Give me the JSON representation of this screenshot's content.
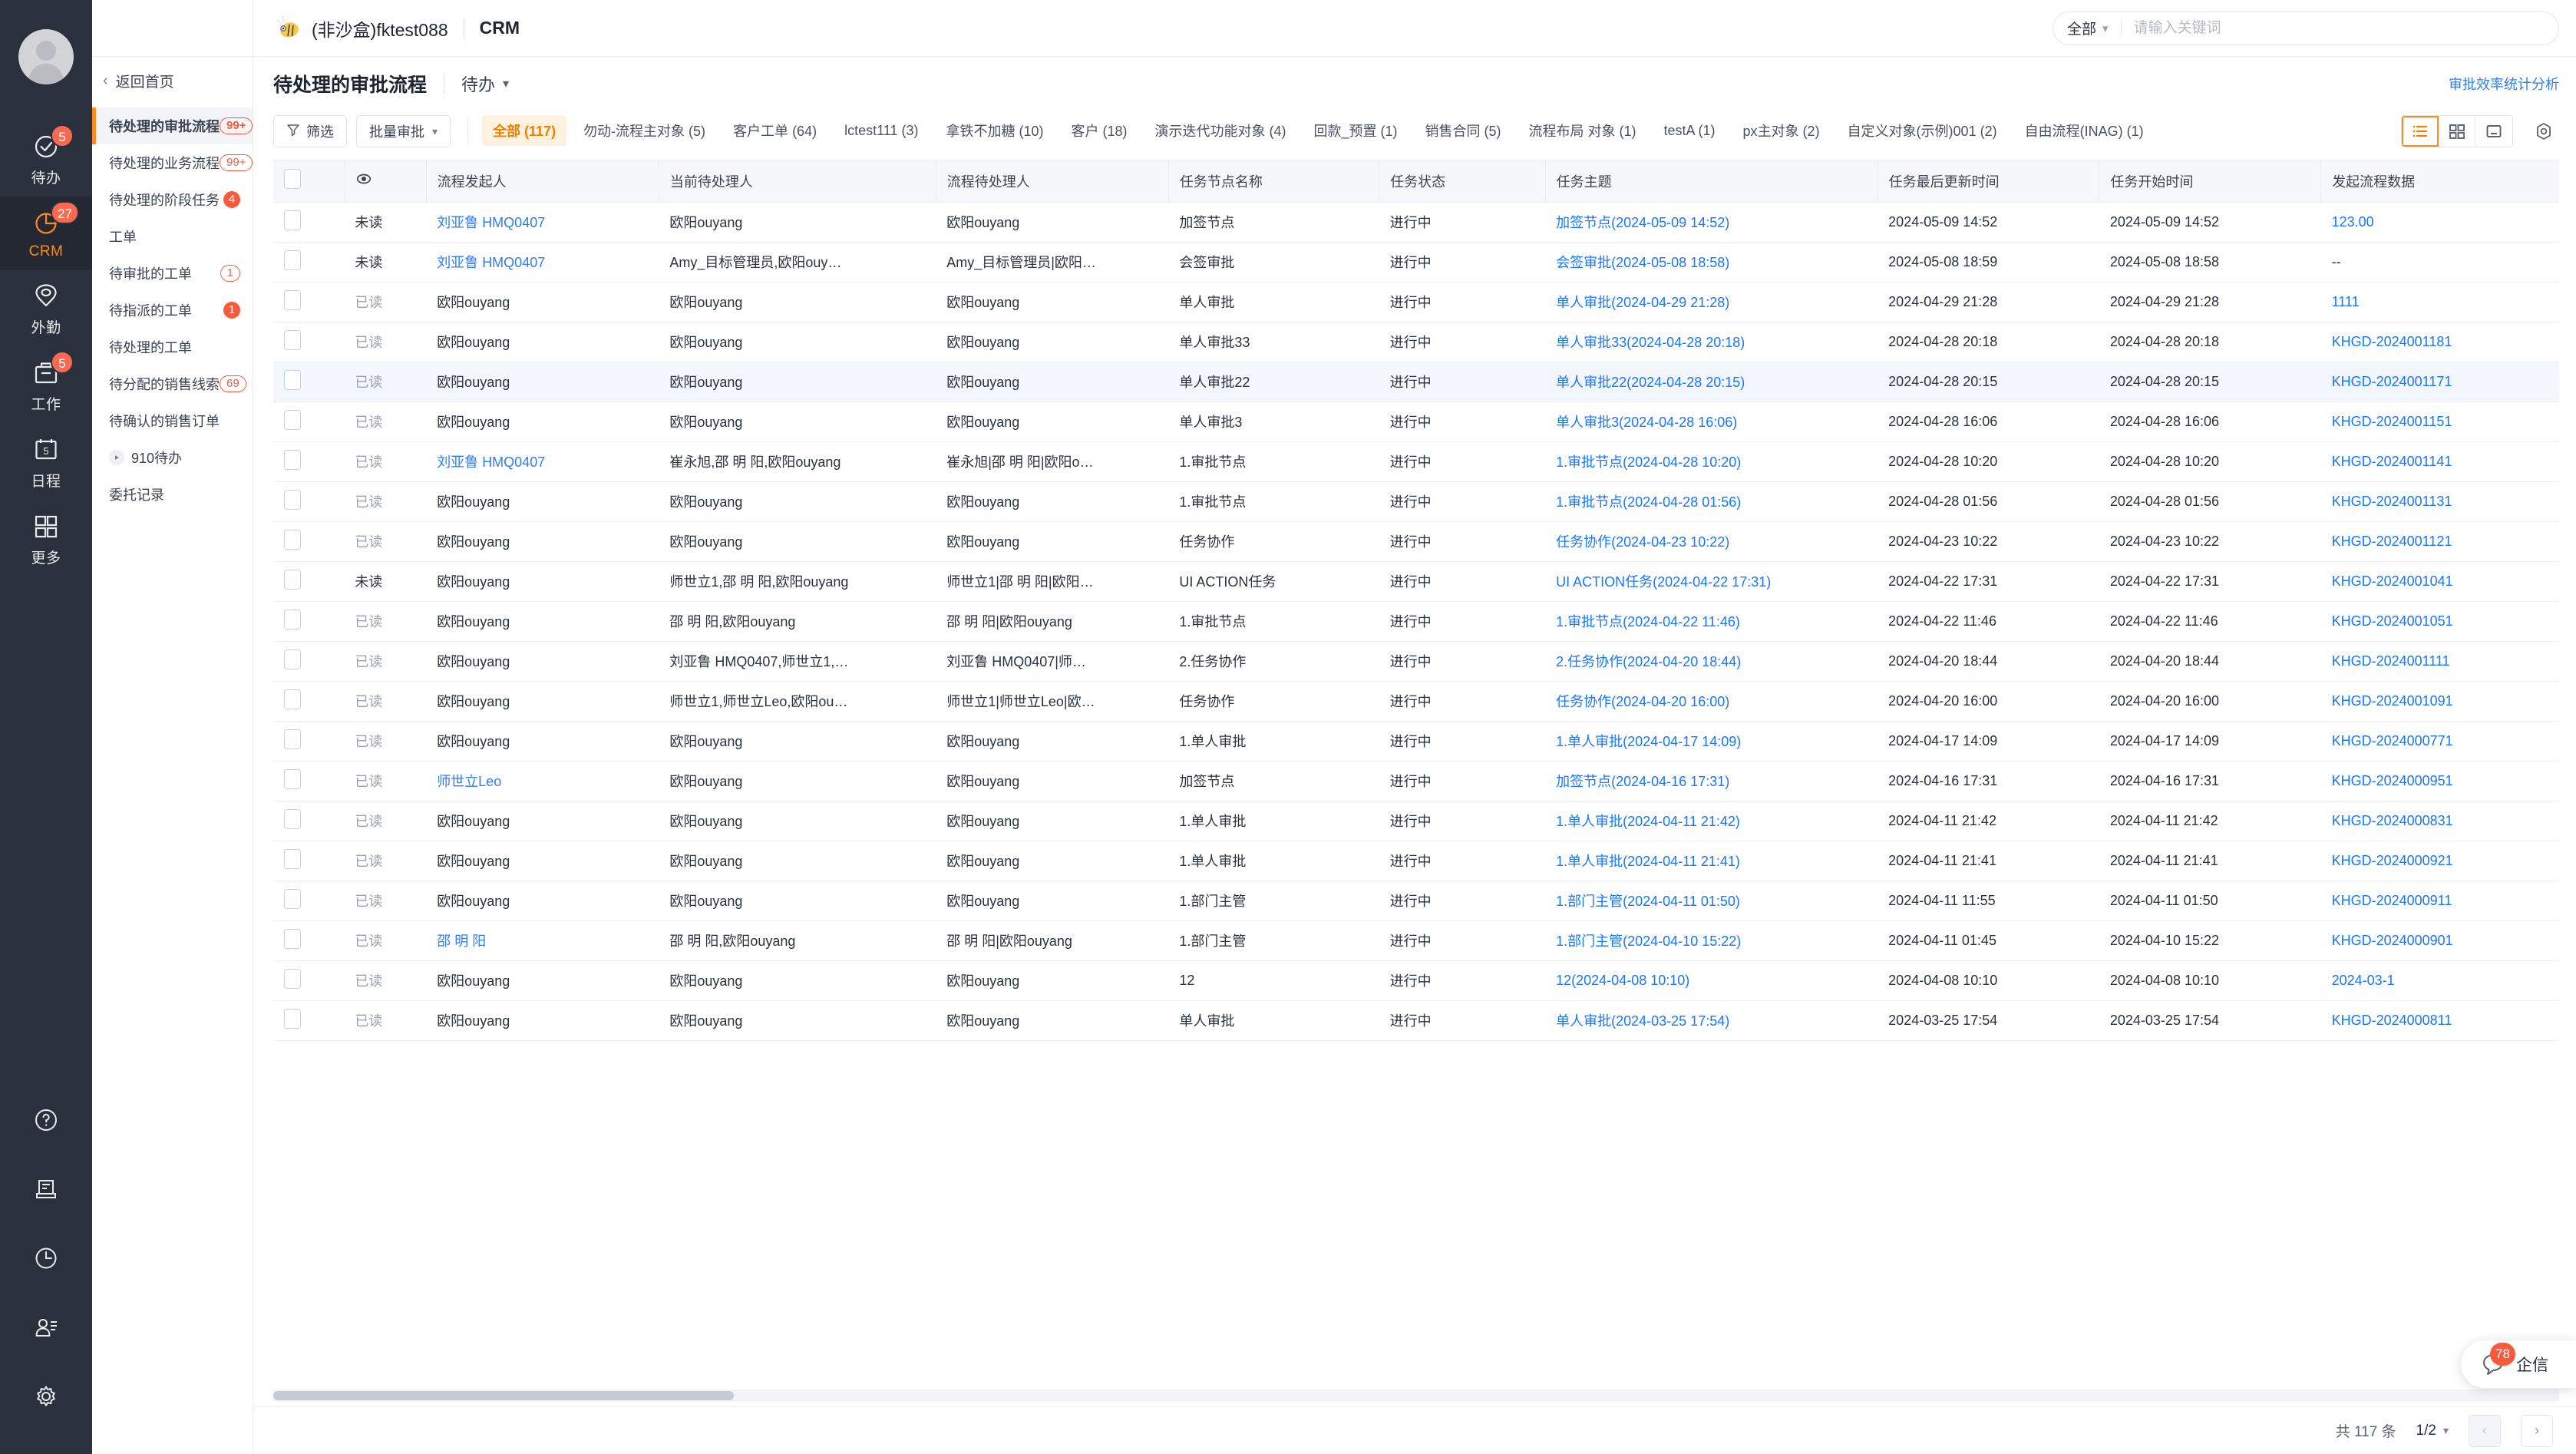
{
  "colors": {
    "accent": "#ff8a1f",
    "link": "#2f7ef0",
    "badge": "#fa5a3c",
    "rail_bg": "#2b313c",
    "chip_active_bg": "#fdf1e0"
  },
  "topbar": {
    "brand_icon": "bee-logo",
    "org_name": "(非沙盒)fktest088",
    "app_name": "CRM",
    "search": {
      "scope": "全部",
      "placeholder": "请输入关键词",
      "value": ""
    }
  },
  "rail": {
    "items": [
      {
        "label": "待办",
        "icon": "check-circle-icon",
        "badge": "5",
        "active": false
      },
      {
        "label": "CRM",
        "icon": "pie-chart-icon",
        "badge": "27",
        "active": true
      },
      {
        "label": "外勤",
        "icon": "location-pin-icon",
        "badge": "",
        "active": false
      },
      {
        "label": "工作",
        "icon": "briefcase-icon",
        "badge": "5",
        "active": false
      },
      {
        "label": "日程",
        "icon": "calendar-icon",
        "badge": "",
        "active": false
      },
      {
        "label": "更多",
        "icon": "grid-icon",
        "badge": "",
        "active": false
      }
    ],
    "bottom_icons": [
      "help-circle-icon",
      "inbox-icon",
      "clock-icon",
      "contacts-icon",
      "gear-icon"
    ]
  },
  "sidebar": {
    "back_label": "返回首页",
    "items": [
      {
        "label": "待处理的审批流程",
        "badge": "99+",
        "badge_style": "hollow",
        "active": true
      },
      {
        "label": "待处理的业务流程",
        "badge": "99+",
        "badge_style": "hollow",
        "active": false
      },
      {
        "label": "待处理的阶段任务",
        "badge": "4",
        "badge_style": "solid",
        "active": false
      },
      {
        "label": "工单",
        "badge": "",
        "badge_style": "none",
        "active": false
      },
      {
        "label": "待审批的工单",
        "badge": "1",
        "badge_style": "hollow",
        "active": false
      },
      {
        "label": "待指派的工单",
        "badge": "1",
        "badge_style": "solid",
        "active": false
      },
      {
        "label": "待处理的工单",
        "badge": "",
        "badge_style": "none",
        "active": false
      },
      {
        "label": "待分配的销售线索",
        "badge": "69",
        "badge_style": "hollow",
        "active": false
      },
      {
        "label": "待确认的销售订单",
        "badge": "",
        "badge_style": "none",
        "active": false
      }
    ],
    "group": {
      "label": "910待办",
      "icon": "triangle-right-icon"
    },
    "tail_item": {
      "label": "委托记录"
    }
  },
  "page": {
    "title": "待处理的审批流程",
    "scope": "待办",
    "stat_link": "审批效率统计分析"
  },
  "toolbar": {
    "filter_label": "筛选",
    "batch_label": "批量审批",
    "view_modes": [
      {
        "name": "list-view",
        "active": true
      },
      {
        "name": "card-view",
        "active": false
      },
      {
        "name": "split-view",
        "active": false
      }
    ],
    "settings_icon": "settings-hex-icon"
  },
  "chips": [
    {
      "label": "全部 (117)",
      "active": true
    },
    {
      "label": "勿动-流程主对象 (5)",
      "active": false
    },
    {
      "label": "客户工单 (64)",
      "active": false
    },
    {
      "label": "lctest111 (3)",
      "active": false
    },
    {
      "label": "拿铁不加糖 (10)",
      "active": false
    },
    {
      "label": "客户 (18)",
      "active": false
    },
    {
      "label": "演示迭代功能对象 (4)",
      "active": false
    },
    {
      "label": "回款_预置 (1)",
      "active": false
    },
    {
      "label": "销售合同 (5)",
      "active": false
    },
    {
      "label": "流程布局 对象 (1)",
      "active": false
    },
    {
      "label": "testA (1)",
      "active": false
    },
    {
      "label": "px主对象 (2)",
      "active": false
    },
    {
      "label": "自定义对象(示例)001 (2)",
      "active": false
    },
    {
      "label": "自由流程(INAG) (1)",
      "active": false
    }
  ],
  "table": {
    "headers": [
      "",
      "",
      "流程发起人",
      "当前待处理人",
      "流程待处理人",
      "任务节点名称",
      "任务状态",
      "任务主题",
      "任务最后更新时间",
      "任务开始时间",
      "发起流程数据"
    ],
    "eye_icon": "eye-icon",
    "rows": [
      {
        "read": "未读",
        "read_state": "unread",
        "initiator": "刘亚鲁 HMQ0407",
        "initiator_link": true,
        "current": "欧阳ouyang",
        "handlers": "欧阳ouyang",
        "node": "加签节点",
        "status": "进行中",
        "subject": "加签节点(2024-05-09 14:52)",
        "updated": "2024-05-09 14:52",
        "started": "2024-05-09 14:52",
        "data": "123.00",
        "data_link": true,
        "highlight": false
      },
      {
        "read": "未读",
        "read_state": "unread",
        "initiator": "刘亚鲁 HMQ0407",
        "initiator_link": true,
        "current": "Amy_目标管理员,欧阳ouy…",
        "handlers": "Amy_目标管理员|欧阳…",
        "node": "会签审批",
        "status": "进行中",
        "subject": "会签审批(2024-05-08 18:58)",
        "updated": "2024-05-08 18:59",
        "started": "2024-05-08 18:58",
        "data": "--",
        "data_link": false,
        "highlight": false
      },
      {
        "read": "已读",
        "read_state": "read",
        "initiator": "欧阳ouyang",
        "initiator_link": false,
        "current": "欧阳ouyang",
        "handlers": "欧阳ouyang",
        "node": "单人审批",
        "status": "进行中",
        "subject": "单人审批(2024-04-29 21:28)",
        "updated": "2024-04-29 21:28",
        "started": "2024-04-29 21:28",
        "data": "1111",
        "data_link": true,
        "highlight": false
      },
      {
        "read": "已读",
        "read_state": "read",
        "initiator": "欧阳ouyang",
        "initiator_link": false,
        "current": "欧阳ouyang",
        "handlers": "欧阳ouyang",
        "node": "单人审批33",
        "status": "进行中",
        "subject": "单人审批33(2024-04-28 20:18)",
        "updated": "2024-04-28 20:18",
        "started": "2024-04-28 20:18",
        "data": "KHGD-2024001181",
        "data_link": true,
        "highlight": false
      },
      {
        "read": "已读",
        "read_state": "read",
        "initiator": "欧阳ouyang",
        "initiator_link": false,
        "current": "欧阳ouyang",
        "handlers": "欧阳ouyang",
        "node": "单人审批22",
        "status": "进行中",
        "subject": "单人审批22(2024-04-28 20:15)",
        "updated": "2024-04-28 20:15",
        "started": "2024-04-28 20:15",
        "data": "KHGD-2024001171",
        "data_link": true,
        "highlight": true
      },
      {
        "read": "已读",
        "read_state": "read",
        "initiator": "欧阳ouyang",
        "initiator_link": false,
        "current": "欧阳ouyang",
        "handlers": "欧阳ouyang",
        "node": "单人审批3",
        "status": "进行中",
        "subject": "单人审批3(2024-04-28 16:06)",
        "updated": "2024-04-28 16:06",
        "started": "2024-04-28 16:06",
        "data": "KHGD-2024001151",
        "data_link": true,
        "highlight": false
      },
      {
        "read": "已读",
        "read_state": "read",
        "initiator": "刘亚鲁 HMQ0407",
        "initiator_link": true,
        "current": "崔永旭,邵 明 阳,欧阳ouyang",
        "handlers": "崔永旭|邵 明 阳|欧阳o…",
        "node": "1.审批节点",
        "status": "进行中",
        "subject": "1.审批节点(2024-04-28 10:20)",
        "updated": "2024-04-28 10:20",
        "started": "2024-04-28 10:20",
        "data": "KHGD-2024001141",
        "data_link": true,
        "highlight": false
      },
      {
        "read": "已读",
        "read_state": "read",
        "initiator": "欧阳ouyang",
        "initiator_link": false,
        "current": "欧阳ouyang",
        "handlers": "欧阳ouyang",
        "node": "1.审批节点",
        "status": "进行中",
        "subject": "1.审批节点(2024-04-28 01:56)",
        "updated": "2024-04-28 01:56",
        "started": "2024-04-28 01:56",
        "data": "KHGD-2024001131",
        "data_link": true,
        "highlight": false
      },
      {
        "read": "已读",
        "read_state": "read",
        "initiator": "欧阳ouyang",
        "initiator_link": false,
        "current": "欧阳ouyang",
        "handlers": "欧阳ouyang",
        "node": "任务协作",
        "status": "进行中",
        "subject": "任务协作(2024-04-23 10:22)",
        "updated": "2024-04-23 10:22",
        "started": "2024-04-23 10:22",
        "data": "KHGD-2024001121",
        "data_link": true,
        "highlight": false
      },
      {
        "read": "未读",
        "read_state": "unread",
        "initiator": "欧阳ouyang",
        "initiator_link": false,
        "current": "师世立1,邵 明 阳,欧阳ouyang",
        "handlers": "师世立1|邵 明 阳|欧阳…",
        "node": "UI ACTION任务",
        "status": "进行中",
        "subject": "UI ACTION任务(2024-04-22 17:31)",
        "updated": "2024-04-22 17:31",
        "started": "2024-04-22 17:31",
        "data": "KHGD-2024001041",
        "data_link": true,
        "highlight": false
      },
      {
        "read": "已读",
        "read_state": "read",
        "initiator": "欧阳ouyang",
        "initiator_link": false,
        "current": "邵 明 阳,欧阳ouyang",
        "handlers": "邵 明 阳|欧阳ouyang",
        "node": "1.审批节点",
        "status": "进行中",
        "subject": "1.审批节点(2024-04-22 11:46)",
        "updated": "2024-04-22 11:46",
        "started": "2024-04-22 11:46",
        "data": "KHGD-2024001051",
        "data_link": true,
        "highlight": false
      },
      {
        "read": "已读",
        "read_state": "read",
        "initiator": "欧阳ouyang",
        "initiator_link": false,
        "current": "刘亚鲁 HMQ0407,师世立1,…",
        "handlers": "刘亚鲁 HMQ0407|师…",
        "node": "2.任务协作",
        "status": "进行中",
        "subject": "2.任务协作(2024-04-20 18:44)",
        "updated": "2024-04-20 18:44",
        "started": "2024-04-20 18:44",
        "data": "KHGD-2024001111",
        "data_link": true,
        "highlight": false
      },
      {
        "read": "已读",
        "read_state": "read",
        "initiator": "欧阳ouyang",
        "initiator_link": false,
        "current": "师世立1,师世立Leo,欧阳ou…",
        "handlers": "师世立1|师世立Leo|欧…",
        "node": "任务协作",
        "status": "进行中",
        "subject": "任务协作(2024-04-20 16:00)",
        "updated": "2024-04-20 16:00",
        "started": "2024-04-20 16:00",
        "data": "KHGD-2024001091",
        "data_link": true,
        "highlight": false
      },
      {
        "read": "已读",
        "read_state": "read",
        "initiator": "欧阳ouyang",
        "initiator_link": false,
        "current": "欧阳ouyang",
        "handlers": "欧阳ouyang",
        "node": "1.单人审批",
        "status": "进行中",
        "subject": "1.单人审批(2024-04-17 14:09)",
        "updated": "2024-04-17 14:09",
        "started": "2024-04-17 14:09",
        "data": "KHGD-2024000771",
        "data_link": true,
        "highlight": false
      },
      {
        "read": "已读",
        "read_state": "read",
        "initiator": "师世立Leo",
        "initiator_link": true,
        "current": "欧阳ouyang",
        "handlers": "欧阳ouyang",
        "node": "加签节点",
        "status": "进行中",
        "subject": "加签节点(2024-04-16 17:31)",
        "updated": "2024-04-16 17:31",
        "started": "2024-04-16 17:31",
        "data": "KHGD-2024000951",
        "data_link": true,
        "highlight": false
      },
      {
        "read": "已读",
        "read_state": "read",
        "initiator": "欧阳ouyang",
        "initiator_link": false,
        "current": "欧阳ouyang",
        "handlers": "欧阳ouyang",
        "node": "1.单人审批",
        "status": "进行中",
        "subject": "1.单人审批(2024-04-11 21:42)",
        "updated": "2024-04-11 21:42",
        "started": "2024-04-11 21:42",
        "data": "KHGD-2024000831",
        "data_link": true,
        "highlight": false
      },
      {
        "read": "已读",
        "read_state": "read",
        "initiator": "欧阳ouyang",
        "initiator_link": false,
        "current": "欧阳ouyang",
        "handlers": "欧阳ouyang",
        "node": "1.单人审批",
        "status": "进行中",
        "subject": "1.单人审批(2024-04-11 21:41)",
        "updated": "2024-04-11 21:41",
        "started": "2024-04-11 21:41",
        "data": "KHGD-2024000921",
        "data_link": true,
        "highlight": false
      },
      {
        "read": "已读",
        "read_state": "read",
        "initiator": "欧阳ouyang",
        "initiator_link": false,
        "current": "欧阳ouyang",
        "handlers": "欧阳ouyang",
        "node": "1.部门主管",
        "status": "进行中",
        "subject": "1.部门主管(2024-04-11 01:50)",
        "updated": "2024-04-11 11:55",
        "started": "2024-04-11 01:50",
        "data": "KHGD-2024000911",
        "data_link": true,
        "highlight": false
      },
      {
        "read": "已读",
        "read_state": "read",
        "initiator": "邵 明 阳",
        "initiator_link": true,
        "current": "邵 明 阳,欧阳ouyang",
        "handlers": "邵 明 阳|欧阳ouyang",
        "node": "1.部门主管",
        "status": "进行中",
        "subject": "1.部门主管(2024-04-10 15:22)",
        "updated": "2024-04-11 01:45",
        "started": "2024-04-10 15:22",
        "data": "KHGD-2024000901",
        "data_link": true,
        "highlight": false
      },
      {
        "read": "已读",
        "read_state": "read",
        "initiator": "欧阳ouyang",
        "initiator_link": false,
        "current": "欧阳ouyang",
        "handlers": "欧阳ouyang",
        "node": "12",
        "status": "进行中",
        "subject": "12(2024-04-08 10:10)",
        "updated": "2024-04-08 10:10",
        "started": "2024-04-08 10:10",
        "data": "2024-03-1",
        "data_link": true,
        "highlight": false
      },
      {
        "read": "已读",
        "read_state": "read",
        "initiator": "欧阳ouyang",
        "initiator_link": false,
        "current": "欧阳ouyang",
        "handlers": "欧阳ouyang",
        "node": "单人审批",
        "status": "进行中",
        "subject": "单人审批(2024-03-25 17:54)",
        "updated": "2024-03-25 17:54",
        "started": "2024-03-25 17:54",
        "data": "KHGD-2024000811",
        "data_link": true,
        "highlight": false
      }
    ]
  },
  "footer": {
    "total": "共 117 条",
    "page": "1/2",
    "prev": "‹",
    "next": "›"
  },
  "chat_widget": {
    "label": "企信",
    "badge": "78",
    "icon": "chat-bubble-icon"
  }
}
